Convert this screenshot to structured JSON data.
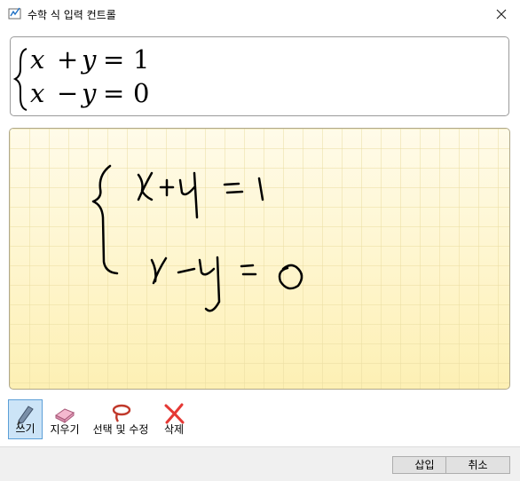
{
  "window": {
    "title": "수학 식 입력 컨트롤"
  },
  "preview": {
    "line1": [
      "x",
      "+",
      "y",
      "=",
      "1"
    ],
    "line2": [
      "x",
      "−",
      "y",
      "=",
      "0"
    ]
  },
  "toolbar": {
    "write_label": "쓰기",
    "erase_label": "지우기",
    "select_label": "선택 및 수정",
    "delete_label": "삭제"
  },
  "buttons": {
    "insert_label": "삽입",
    "cancel_label": "취소"
  }
}
